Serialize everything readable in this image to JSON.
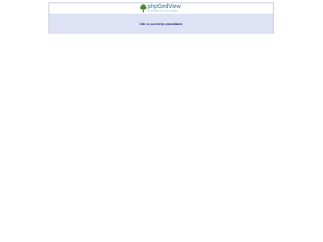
{
  "header": {
    "logo_title": "phpGedView",
    "logo_subtitle": "the genealogy tool - on-line and offline"
  },
  "main": {
    "status_message": "Site is currently unavailable"
  },
  "icons": {
    "logo": "tree-icon"
  },
  "colors": {
    "message_background": "#dfe2f5",
    "message_text": "#1a1a80",
    "logo_text": "#1f5f8f",
    "border": "#c8c8d8"
  }
}
